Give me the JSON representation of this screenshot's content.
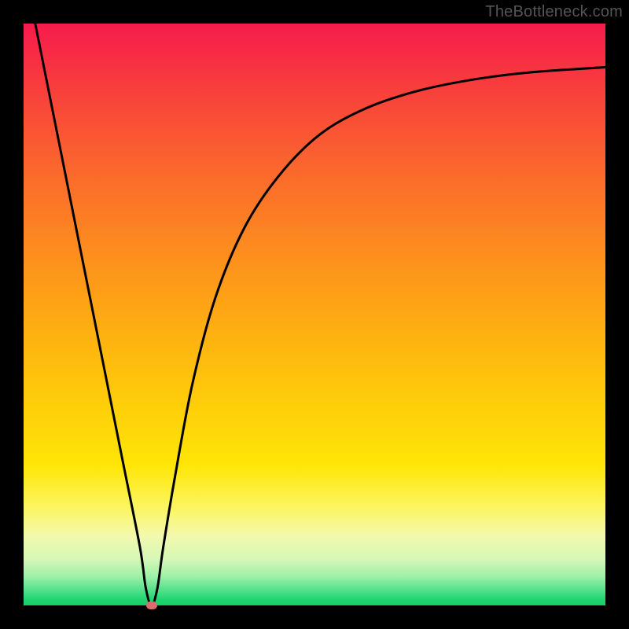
{
  "watermark": "TheBottleneck.com",
  "colors": {
    "frame_background": "#000000",
    "curve_stroke": "#000000",
    "valley_marker": "#de6b6e",
    "gradient_stops": [
      "#f61b4c",
      "#fb6a2c",
      "#feb210",
      "#fee607",
      "#f3f9ad",
      "#4fe089",
      "#16cf66"
    ]
  },
  "chart_data": {
    "type": "line",
    "title": "",
    "xlabel": "",
    "ylabel": "",
    "xlim": [
      0,
      100
    ],
    "ylim": [
      0,
      100
    ],
    "grid": false,
    "legend": false,
    "note": "Values estimated from pixel positions; chart has no visible tick labels or axis titles.",
    "series": [
      {
        "name": "bottleneck-curve",
        "x": [
          2,
          5,
          8,
          11,
          14,
          17,
          20,
          21,
          22,
          23,
          24,
          26,
          29,
          33,
          38,
          44,
          51,
          59,
          68,
          78,
          88,
          100
        ],
        "y": [
          100,
          85,
          70,
          55,
          40,
          25,
          10,
          3,
          0,
          3,
          10,
          22,
          38,
          53,
          65,
          74,
          81,
          85.5,
          88.5,
          90.5,
          91.7,
          92.5
        ]
      }
    ],
    "markers": [
      {
        "name": "valley-min",
        "x": 22,
        "y": 0
      }
    ]
  }
}
